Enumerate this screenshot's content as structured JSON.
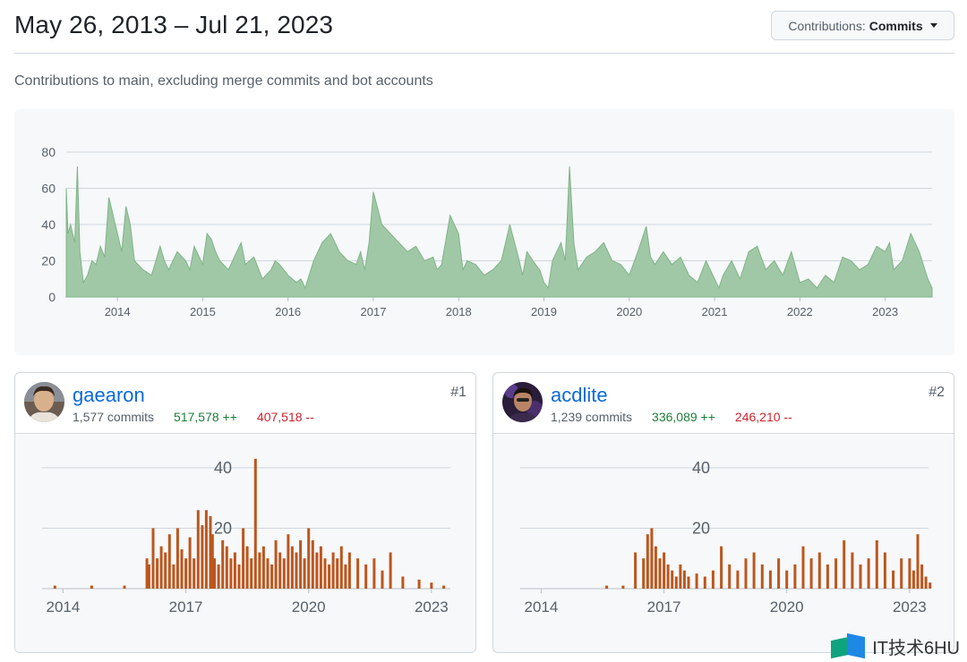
{
  "header": {
    "title": "May 26, 2013 – Jul 21, 2023",
    "contrib_prefix": "Contributions:",
    "contrib_value": "Commits"
  },
  "subtitle": "Contributions to main, excluding merge commits and bot accounts",
  "colors": {
    "main_fill": "#a0c8a6",
    "main_stroke": "#7fb386",
    "user_fill": "#bd561d",
    "grid": "#d0d7de",
    "link": "#0969da",
    "adds": "#1a7f37",
    "dels": "#cf222e"
  },
  "chart_data": [
    {
      "id": "main",
      "type": "area",
      "ylim": [
        0,
        80
      ],
      "y_ticks": [
        0,
        20,
        40,
        60,
        80
      ],
      "xlim": [
        2013.4,
        2023.55
      ],
      "x_ticks": [
        2014,
        2015,
        2016,
        2017,
        2018,
        2019,
        2020,
        2021,
        2022,
        2023
      ],
      "grid": true,
      "series": [
        {
          "x": [
            2013.4,
            2013.42,
            2013.45,
            2013.5,
            2013.53,
            2013.56,
            2013.6,
            2013.65,
            2013.7,
            2013.75,
            2013.8,
            2013.85,
            2013.9,
            2013.95,
            2014.0,
            2014.05,
            2014.1,
            2014.15,
            2014.2,
            2014.3,
            2014.4,
            2014.5,
            2014.55,
            2014.6,
            2014.7,
            2014.8,
            2014.85,
            2014.9,
            2015.0,
            2015.05,
            2015.1,
            2015.15,
            2015.2,
            2015.3,
            2015.4,
            2015.45,
            2015.5,
            2015.6,
            2015.7,
            2015.8,
            2015.85,
            2015.9,
            2016.0,
            2016.1,
            2016.15,
            2016.2,
            2016.3,
            2016.4,
            2016.5,
            2016.6,
            2016.7,
            2016.8,
            2016.85,
            2016.9,
            2016.95,
            2017.0,
            2017.1,
            2017.2,
            2017.3,
            2017.4,
            2017.5,
            2017.6,
            2017.7,
            2017.75,
            2017.8,
            2017.9,
            2018.0,
            2018.05,
            2018.1,
            2018.2,
            2018.3,
            2018.4,
            2018.5,
            2018.6,
            2018.7,
            2018.75,
            2018.8,
            2018.9,
            2018.95,
            2019.0,
            2019.05,
            2019.1,
            2019.15,
            2019.2,
            2019.25,
            2019.3,
            2019.35,
            2019.4,
            2019.5,
            2019.6,
            2019.7,
            2019.8,
            2019.9,
            2020.0,
            2020.1,
            2020.2,
            2020.25,
            2020.3,
            2020.4,
            2020.5,
            2020.6,
            2020.7,
            2020.8,
            2020.9,
            2021.0,
            2021.05,
            2021.1,
            2021.2,
            2021.3,
            2021.4,
            2021.5,
            2021.6,
            2021.7,
            2021.8,
            2021.9,
            2022.0,
            2022.1,
            2022.2,
            2022.3,
            2022.4,
            2022.5,
            2022.6,
            2022.7,
            2022.8,
            2022.9,
            2023.0,
            2023.05,
            2023.1,
            2023.2,
            2023.3,
            2023.4,
            2023.5,
            2023.55
          ],
          "values": [
            60,
            35,
            40,
            30,
            72,
            25,
            8,
            12,
            20,
            18,
            28,
            22,
            55,
            45,
            35,
            25,
            50,
            40,
            20,
            15,
            12,
            28,
            20,
            15,
            25,
            20,
            15,
            28,
            18,
            35,
            32,
            25,
            20,
            15,
            25,
            30,
            18,
            22,
            10,
            15,
            20,
            18,
            12,
            8,
            10,
            5,
            20,
            30,
            35,
            25,
            20,
            18,
            25,
            15,
            30,
            58,
            40,
            35,
            30,
            25,
            28,
            20,
            22,
            15,
            18,
            45,
            35,
            15,
            20,
            18,
            12,
            15,
            20,
            40,
            22,
            12,
            25,
            18,
            15,
            8,
            5,
            20,
            25,
            30,
            20,
            72,
            30,
            15,
            22,
            25,
            30,
            20,
            18,
            12,
            25,
            39,
            22,
            18,
            25,
            18,
            22,
            12,
            8,
            20,
            10,
            5,
            12,
            20,
            10,
            25,
            28,
            15,
            20,
            12,
            25,
            8,
            10,
            5,
            12,
            8,
            22,
            20,
            15,
            18,
            28,
            25,
            30,
            15,
            20,
            35,
            25,
            10,
            5
          ]
        }
      ]
    },
    {
      "id": "user1",
      "type": "bar",
      "ylim": [
        0,
        45
      ],
      "y_ticks": [
        20,
        40
      ],
      "xlim": [
        2013.4,
        2023.55
      ],
      "x_ticks": [
        2014,
        2017,
        2020,
        2023
      ],
      "grid": true,
      "series": [
        {
          "x": [
            2013.8,
            2014.7,
            2015.5,
            2016.05,
            2016.1,
            2016.2,
            2016.3,
            2016.4,
            2016.5,
            2016.6,
            2016.7,
            2016.8,
            2016.9,
            2017.0,
            2017.1,
            2017.2,
            2017.3,
            2017.4,
            2017.5,
            2017.6,
            2017.65,
            2017.7,
            2017.8,
            2017.9,
            2018.0,
            2018.1,
            2018.2,
            2018.3,
            2018.4,
            2018.5,
            2018.6,
            2018.7,
            2018.8,
            2018.9,
            2019.0,
            2019.1,
            2019.2,
            2019.3,
            2019.4,
            2019.5,
            2019.6,
            2019.7,
            2019.8,
            2019.9,
            2020.0,
            2020.1,
            2020.2,
            2020.3,
            2020.4,
            2020.5,
            2020.6,
            2020.7,
            2020.8,
            2020.9,
            2021.0,
            2021.2,
            2021.4,
            2021.6,
            2021.8,
            2022.0,
            2022.3,
            2022.7,
            2023.0,
            2023.3
          ],
          "values": [
            1,
            1,
            1,
            10,
            8,
            20,
            10,
            14,
            12,
            18,
            8,
            20,
            13,
            10,
            17,
            10,
            26,
            21,
            26,
            24,
            18,
            10,
            8,
            16,
            14,
            10,
            12,
            8,
            20,
            14,
            10,
            43,
            12,
            14,
            10,
            8,
            16,
            12,
            10,
            18,
            14,
            12,
            16,
            10,
            20,
            16,
            12,
            14,
            10,
            8,
            12,
            10,
            14,
            8,
            12,
            10,
            8,
            10,
            6,
            12,
            4,
            3,
            2,
            1
          ]
        }
      ]
    },
    {
      "id": "user2",
      "type": "bar",
      "ylim": [
        0,
        45
      ],
      "y_ticks": [
        20,
        40
      ],
      "xlim": [
        2013.4,
        2023.55
      ],
      "x_ticks": [
        2014,
        2017,
        2020,
        2023
      ],
      "grid": true,
      "series": [
        {
          "x": [
            2015.6,
            2016.0,
            2016.3,
            2016.5,
            2016.6,
            2016.7,
            2016.8,
            2016.9,
            2017.0,
            2017.1,
            2017.2,
            2017.3,
            2017.4,
            2017.5,
            2017.6,
            2017.8,
            2018.0,
            2018.2,
            2018.4,
            2018.6,
            2018.8,
            2019.0,
            2019.2,
            2019.4,
            2019.6,
            2019.8,
            2020.0,
            2020.2,
            2020.4,
            2020.6,
            2020.8,
            2021.0,
            2021.2,
            2021.4,
            2021.6,
            2021.8,
            2022.0,
            2022.2,
            2022.4,
            2022.6,
            2022.8,
            2023.0,
            2023.1,
            2023.2,
            2023.3,
            2023.4,
            2023.5
          ],
          "values": [
            1,
            1,
            12,
            10,
            18,
            20,
            14,
            10,
            12,
            8,
            6,
            4,
            8,
            6,
            4,
            5,
            4,
            6,
            14,
            8,
            6,
            10,
            12,
            8,
            6,
            10,
            6,
            8,
            14,
            10,
            12,
            8,
            10,
            16,
            12,
            8,
            10,
            16,
            12,
            6,
            10,
            10,
            6,
            18,
            8,
            4,
            2
          ]
        }
      ]
    }
  ],
  "axis_labels": {
    "main_y": [
      "0",
      "20",
      "40",
      "60",
      "80"
    ],
    "main_x": [
      "2014",
      "2015",
      "2016",
      "2017",
      "2018",
      "2019",
      "2020",
      "2021",
      "2022",
      "2023"
    ],
    "user_y": [
      "20",
      "40"
    ],
    "user_x": [
      "2014",
      "2017",
      "2020",
      "2023"
    ]
  },
  "contributors": [
    {
      "username": "gaearon",
      "commits": "1,577 commits",
      "additions": "517,578 ++",
      "deletions": "407,518 --",
      "rank": "#1",
      "avatar_icon": "person-avatar"
    },
    {
      "username": "acdlite",
      "commits": "1,239 commits",
      "additions": "336,089 ++",
      "deletions": "246,210 --",
      "rank": "#2",
      "avatar_icon": "person-avatar"
    }
  ],
  "watermark": {
    "text": "IT技术6HU"
  }
}
